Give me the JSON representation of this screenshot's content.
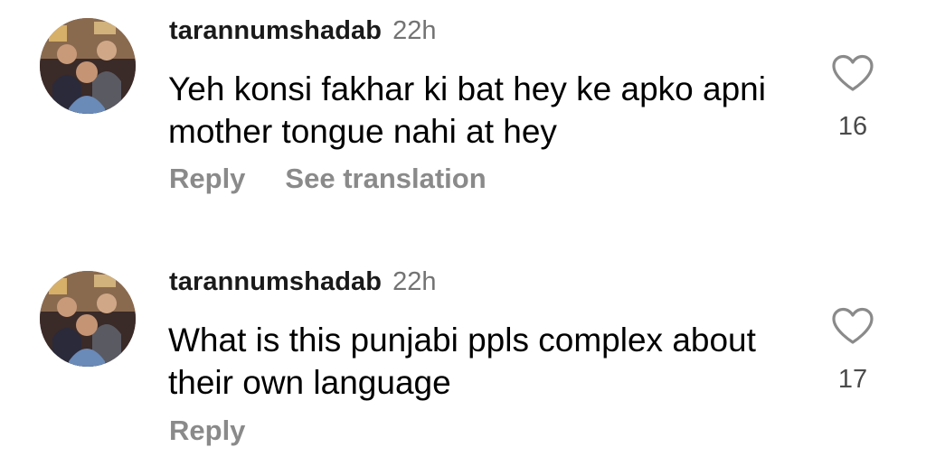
{
  "comments": [
    {
      "username": "tarannumshadab",
      "timestamp": "22h",
      "text": "Yeh konsi fakhar ki bat hey ke apko apni mother tongue nahi at hey",
      "reply_label": "Reply",
      "translate_label": "See translation",
      "likes": "16",
      "like_icon": "heart-outline-icon",
      "avatar_icon": "profile-photo-avatar"
    },
    {
      "username": "tarannumshadab",
      "timestamp": "22h",
      "text": "What is this punjabi ppls complex about their own language",
      "reply_label": "Reply",
      "likes": "17",
      "like_icon": "heart-outline-icon",
      "avatar_icon": "profile-photo-avatar"
    }
  ],
  "colors": {
    "username": "#1a1a1a",
    "muted": "#737373",
    "action": "#8a8a8a",
    "text": "#000000",
    "background": "#ffffff"
  }
}
